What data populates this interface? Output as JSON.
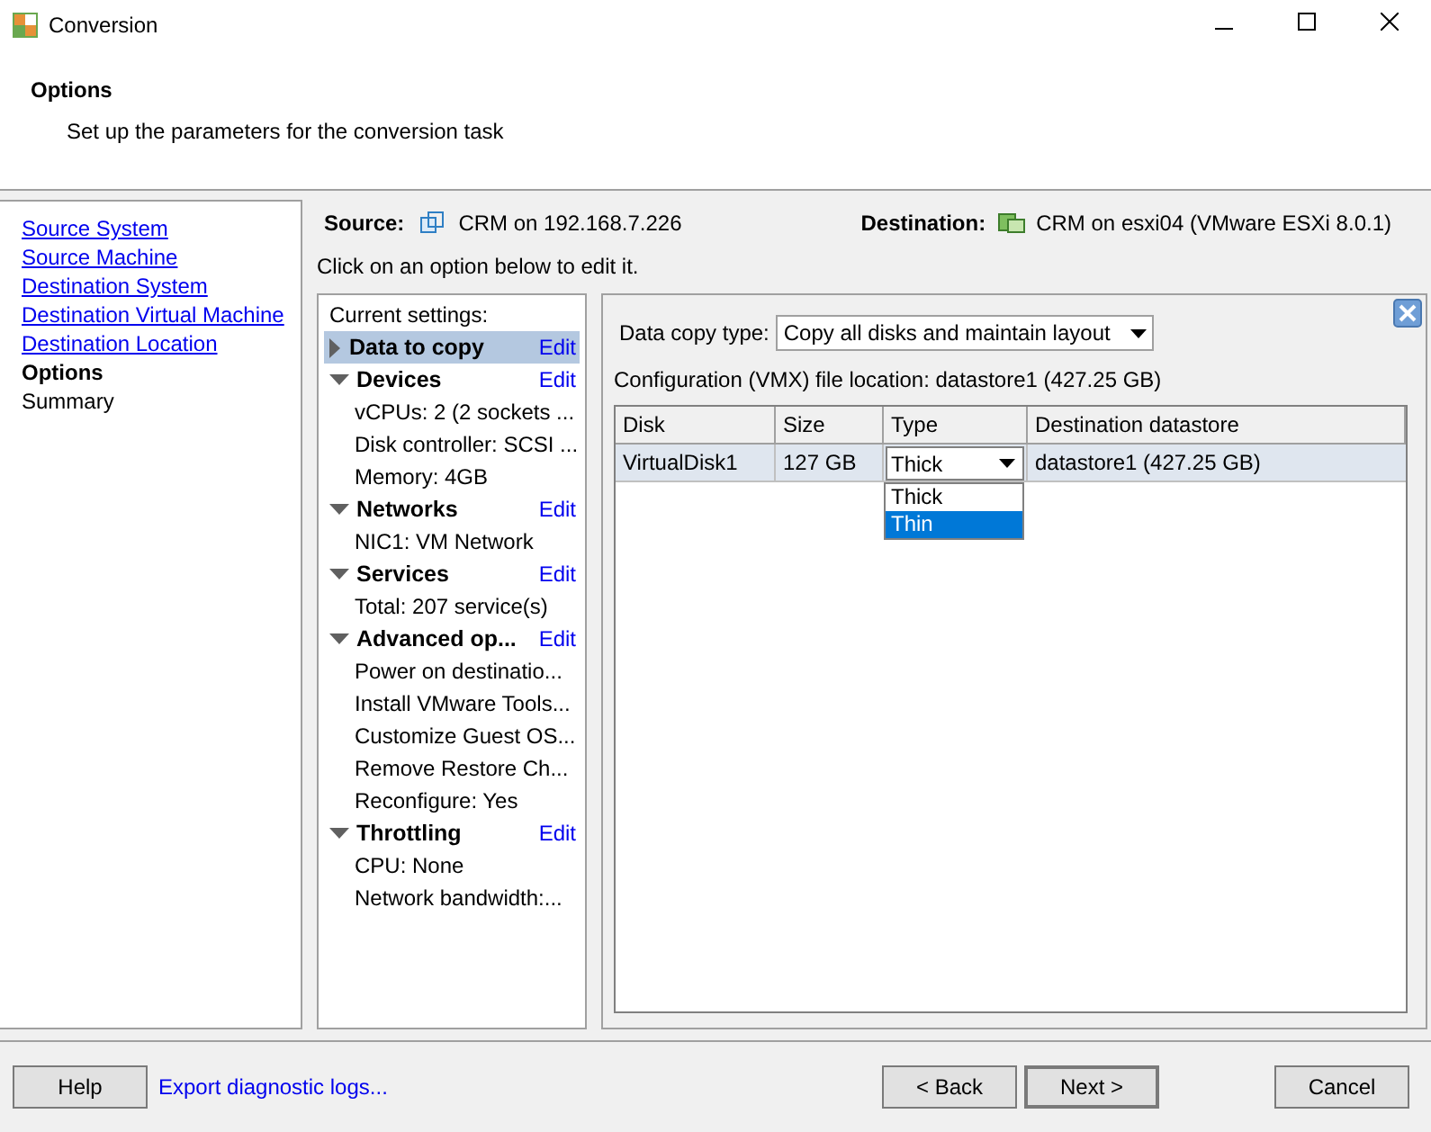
{
  "window": {
    "title": "Conversion"
  },
  "header": {
    "title": "Options",
    "subtitle": "Set up the parameters for the conversion task"
  },
  "steps": [
    {
      "label": "Source System",
      "kind": "link"
    },
    {
      "label": "Source Machine",
      "kind": "link"
    },
    {
      "label": "Destination System",
      "kind": "link"
    },
    {
      "label": "Destination Virtual Machine",
      "kind": "link"
    },
    {
      "label": "Destination Location",
      "kind": "link"
    },
    {
      "label": "Options",
      "kind": "current"
    },
    {
      "label": "Summary",
      "kind": "plain"
    }
  ],
  "source": {
    "label": "Source:",
    "value": "CRM on 192.168.7.226"
  },
  "destination": {
    "label": "Destination:",
    "value": "CRM on esxi04 (VMware ESXi 8.0.1)"
  },
  "instruction": "Click on an option below to edit it.",
  "settings": {
    "heading": "Current settings:",
    "groups": [
      {
        "label": "Data to copy",
        "edit": "Edit",
        "expanded": false,
        "selected": true
      },
      {
        "label": "Devices",
        "edit": "Edit",
        "expanded": true,
        "selected": false,
        "items": [
          "vCPUs: 2 (2 sockets ...",
          "Disk controller: SCSI ...",
          "Memory: 4GB"
        ]
      },
      {
        "label": "Networks",
        "edit": "Edit",
        "expanded": true,
        "selected": false,
        "items": [
          "NIC1: VM Network"
        ]
      },
      {
        "label": "Services",
        "edit": "Edit",
        "expanded": true,
        "selected": false,
        "items": [
          "Total: 207 service(s)"
        ]
      },
      {
        "label": "Advanced op...",
        "edit": "Edit",
        "expanded": true,
        "selected": false,
        "items": [
          "Power on destinatio...",
          "Install VMware Tools...",
          "Customize Guest OS...",
          "Remove Restore Ch...",
          "Reconfigure: Yes"
        ]
      },
      {
        "label": "Throttling",
        "edit": "Edit",
        "expanded": true,
        "selected": false,
        "items": [
          "CPU: None",
          "Network bandwidth:..."
        ]
      }
    ]
  },
  "options": {
    "data_copy_type": {
      "label": "Data copy type:",
      "value": "Copy all disks and maintain layout"
    },
    "config_location": "Configuration (VMX) file location: datastore1 (427.25 GB)",
    "disks": {
      "columns": [
        "Disk",
        "Size",
        "Type",
        "Destination datastore"
      ],
      "rows": [
        {
          "disk": "VirtualDisk1",
          "size": "127 GB",
          "type": "Thick",
          "datastore": "datastore1 (427.25 GB)",
          "selected": true
        }
      ]
    },
    "type_menu": [
      {
        "label": "Thick",
        "selected": false
      },
      {
        "label": "Thin",
        "selected": true
      }
    ]
  },
  "footer": {
    "help": "Help",
    "export": "Export diagnostic logs...",
    "back": "< Back",
    "next": "Next >",
    "cancel": "Cancel"
  }
}
